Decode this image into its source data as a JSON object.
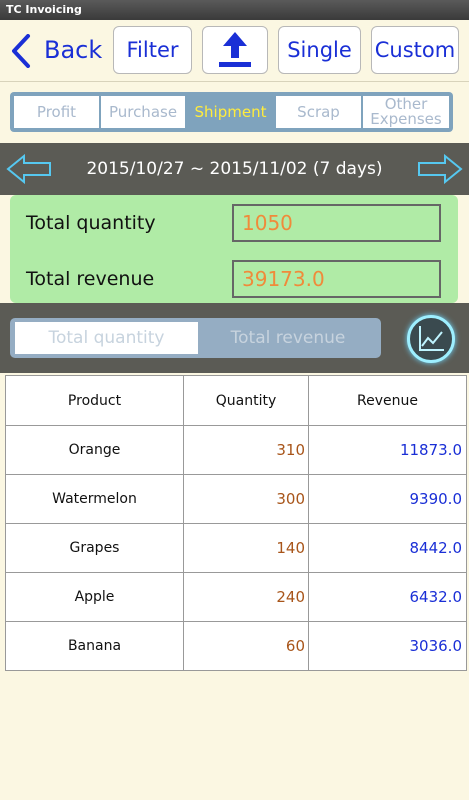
{
  "app": {
    "title": "TC Invoicing"
  },
  "toolbar": {
    "back_label": "Back",
    "filter_label": "Filter",
    "upload_icon": "upload-icon",
    "single_label": "Single",
    "custom_label": "Custom"
  },
  "tabs": [
    {
      "label": "Profit",
      "active": false
    },
    {
      "label": "Purchase",
      "active": false
    },
    {
      "label": "Shipment",
      "active": true
    },
    {
      "label": "Scrap",
      "active": false
    },
    {
      "label": "Other Expenses",
      "active": false
    }
  ],
  "date_nav": {
    "range": "2015/10/27 ~ 2015/11/02  (7 days)"
  },
  "summary": {
    "quantity_label": "Total quantity",
    "quantity_value": "1050",
    "revenue_label": "Total revenue",
    "revenue_value": "39173.0"
  },
  "toggle": {
    "quantity_label": "Total quantity",
    "revenue_label": "Total revenue"
  },
  "table": {
    "headers": [
      "Product",
      "Quantity",
      "Revenue"
    ],
    "rows": [
      [
        "Orange",
        "310",
        "11873.0"
      ],
      [
        "Watermelon",
        "300",
        "9390.0"
      ],
      [
        "Grapes",
        "140",
        "8442.0"
      ],
      [
        "Apple",
        "240",
        "6432.0"
      ],
      [
        "Banana",
        "60",
        "3036.0"
      ]
    ]
  },
  "colors": {
    "accent_blue": "#1a2fd6",
    "active_tab_text": "#ffec3d",
    "summary_bg": "#b0eba6",
    "value_orange": "#f08a3a"
  }
}
